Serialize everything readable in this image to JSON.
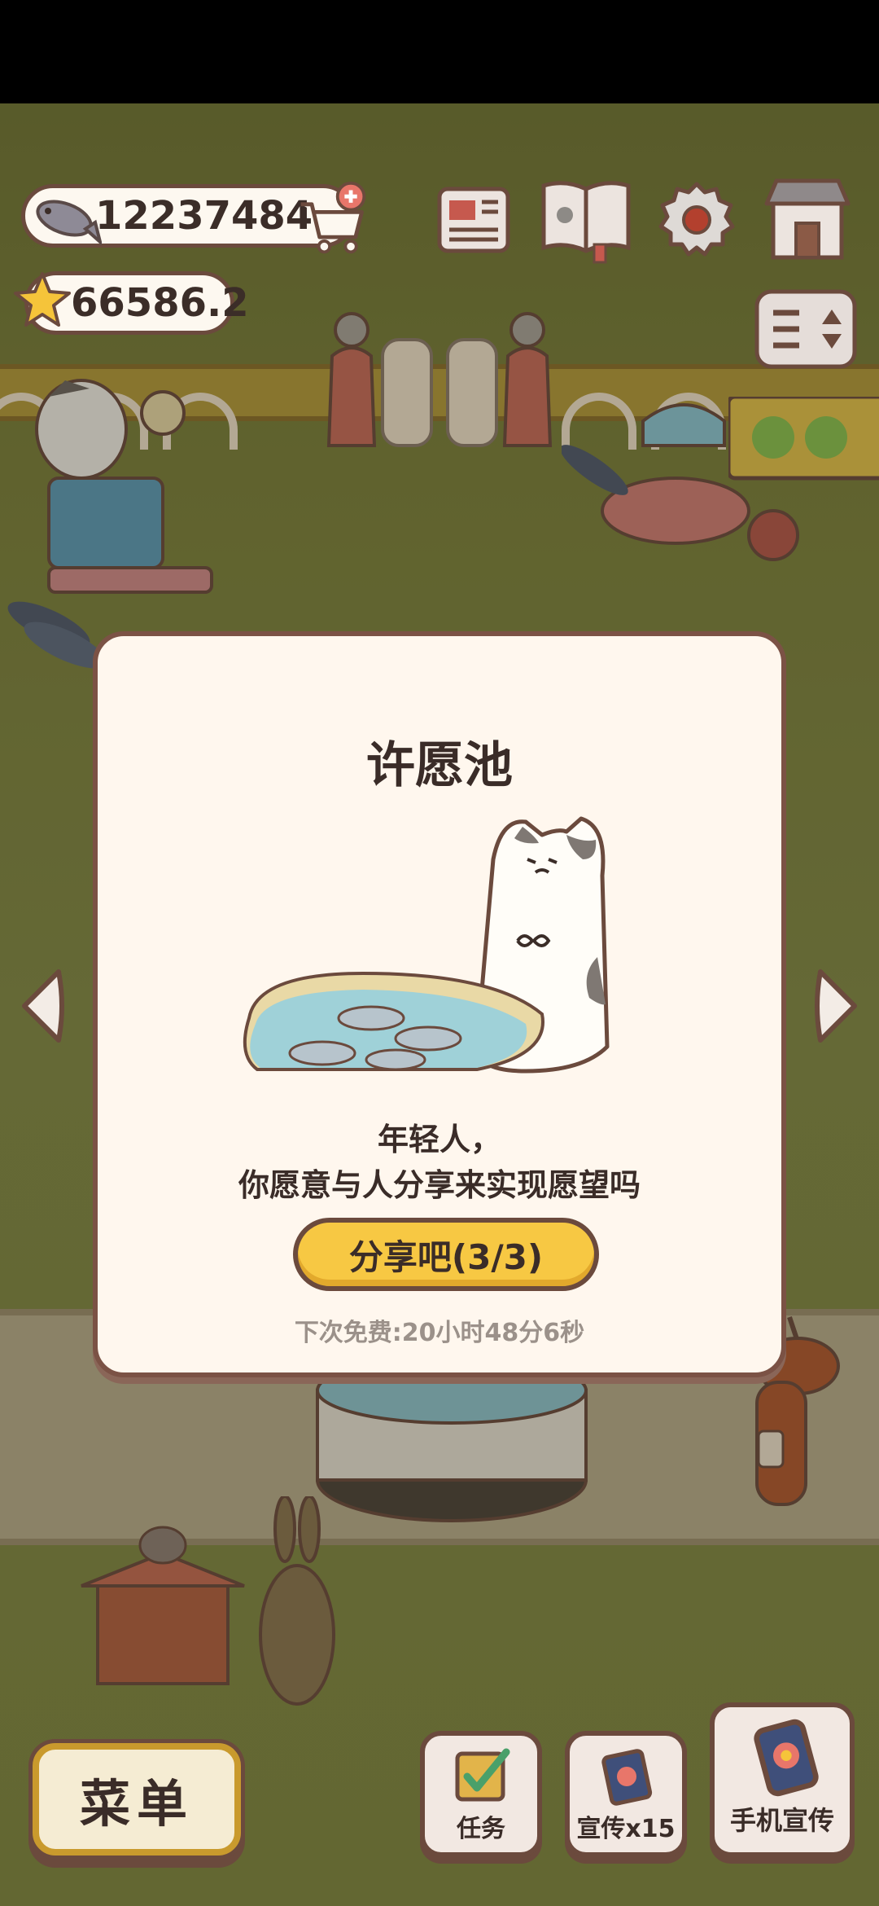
{
  "hud": {
    "fish_count": "12237484",
    "star_count": "66586.2"
  },
  "dialog": {
    "title": "许愿池",
    "message_line1": "年轻人，",
    "message_line2": "你愿意与人分享来实现愿望吗",
    "share_button": "分享吧(3/3)",
    "free_timer": "下次免费:20小时48分6秒"
  },
  "bottom_bar": {
    "menu": "菜单",
    "tasks": "任务",
    "promote": "宣传x15",
    "phone_promote": "手机宣传"
  },
  "colors": {
    "dialog_bg": "#fff7ee",
    "border_brown": "#6b4a3d",
    "button_yellow": "#f7c843",
    "grass": "#7f8640"
  },
  "icons": [
    "fish-icon",
    "shop-cart-icon",
    "star-icon",
    "newspaper-icon",
    "book-icon",
    "gear-icon",
    "shop-icon",
    "sort-toggle-icon",
    "arrow-left-icon",
    "arrow-right-icon",
    "checklist-icon",
    "flyer-icon",
    "phone-promote-icon"
  ]
}
